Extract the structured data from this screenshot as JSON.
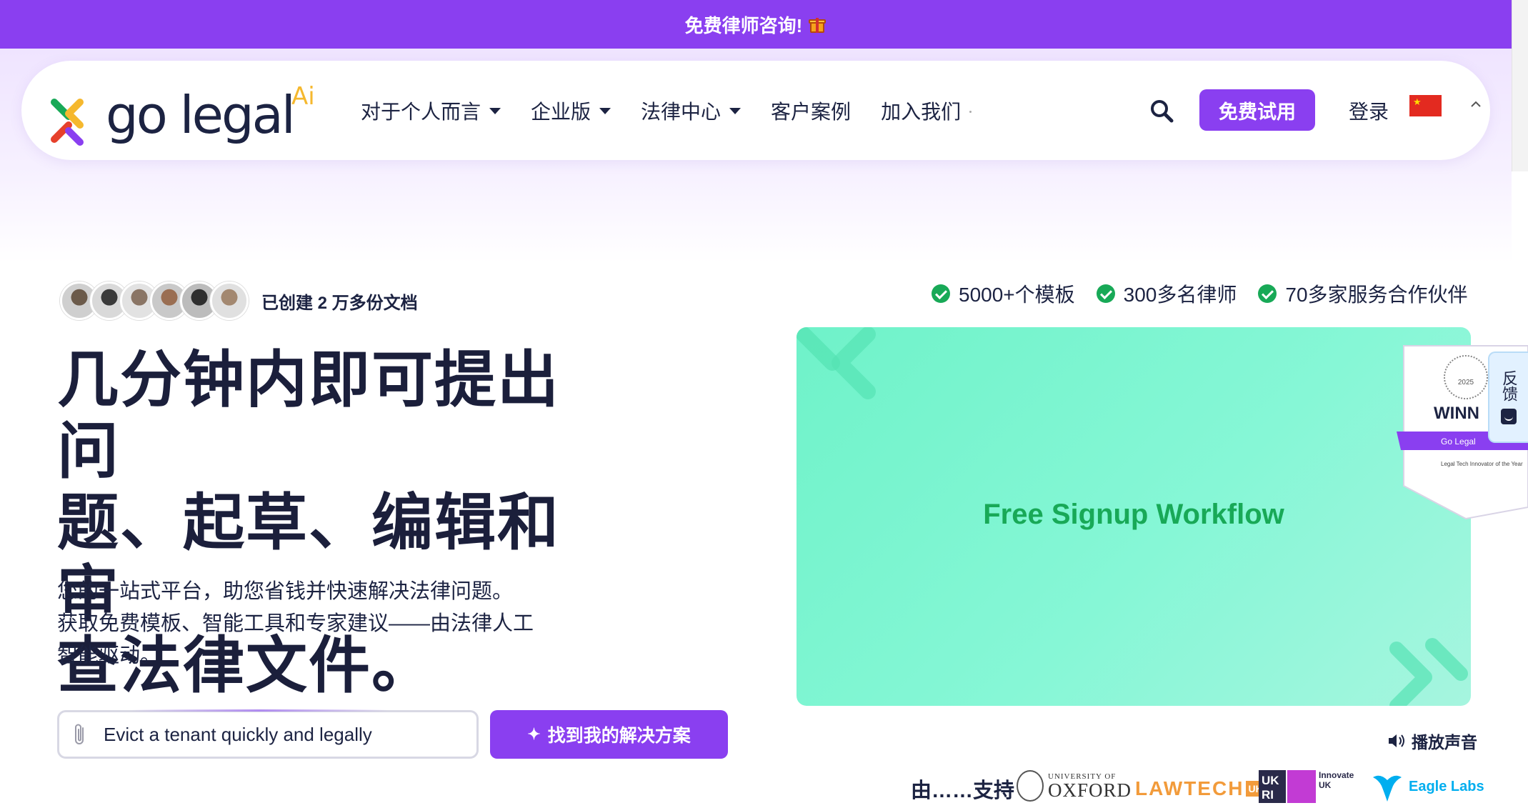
{
  "promo": {
    "text": "免费律师咨询!",
    "icon": "gift-icon"
  },
  "brand": {
    "name": "go legal",
    "suffix": "Ai",
    "colors": {
      "purple": "#8a3ff0",
      "navy": "#1c2342",
      "green": "#18a957",
      "mint": "#7ff5d0",
      "gold": "#f5b82e"
    }
  },
  "nav": {
    "items": [
      {
        "label": "对于个人而言",
        "dropdown": true
      },
      {
        "label": "企业版",
        "dropdown": true
      },
      {
        "label": "法律中心",
        "dropdown": true
      },
      {
        "label": "客户案例",
        "dropdown": false
      },
      {
        "label": "加入我们",
        "dropdown": false
      }
    ],
    "trial_label": "免费试用",
    "login_label": "登录",
    "language_flag": "china-flag-icon"
  },
  "social_proof": {
    "docs_created": "已创建 2 万多份文档"
  },
  "stats": [
    {
      "label": "5000+个模板"
    },
    {
      "label": "300多名律师"
    },
    {
      "label": "70多家服务合作伙伴"
    }
  ],
  "hero": {
    "headline_lines": [
      "几分钟内即可提出问",
      "题、起草、编辑和审",
      "查法律文件。"
    ],
    "subtext_lines": [
      "您的一站式平台，助您省钱并快速解决法律问题。",
      "获取免费模板、智能工具和专家建议——由法律人工",
      "智能驱动。"
    ]
  },
  "search": {
    "value": "Evict a tenant quickly and legally",
    "button_label": "找到我的解决方案"
  },
  "video": {
    "title": "Free Signup Workflow",
    "sound_label": "播放声音"
  },
  "award": {
    "heading": "WINN",
    "name": "Go Legal",
    "caption": "Legal Tech Innovator of the Year",
    "year": "2025"
  },
  "feedback": {
    "label": "反馈"
  },
  "partners": {
    "label": "由……支持",
    "oxford_small": "UNIVERSITY OF",
    "oxford_big": "OXFORD",
    "lawtech": "LAWTECH",
    "lawtech_uk": "UK",
    "innovate_line1": "Innovate",
    "innovate_line2": "UK",
    "eagle": "Eagle Labs"
  }
}
